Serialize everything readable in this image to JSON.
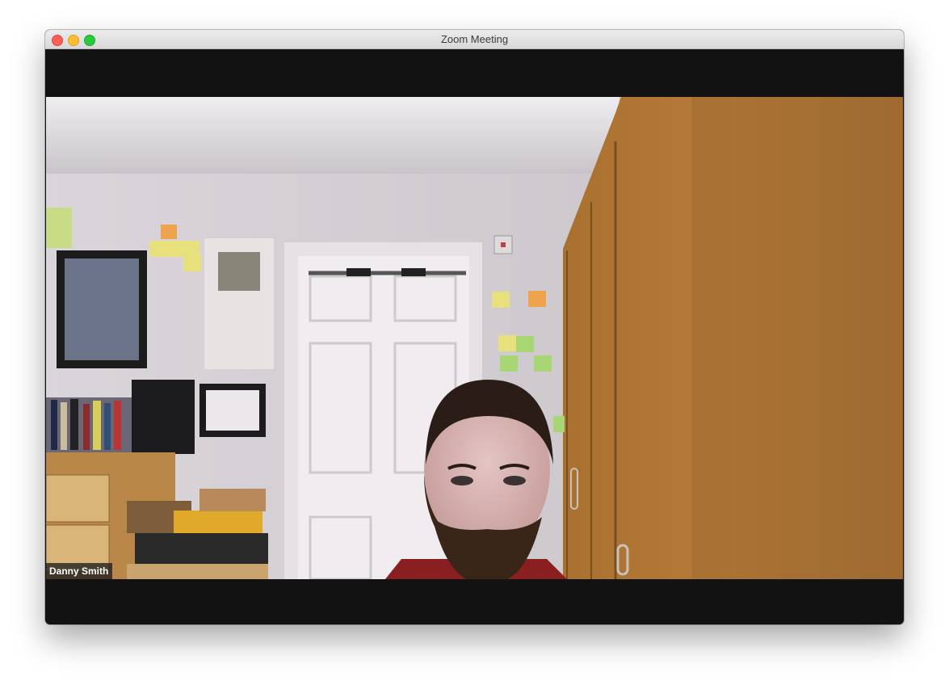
{
  "window": {
    "title": "Zoom Meeting",
    "controls": [
      "close",
      "minimize",
      "maximize"
    ]
  },
  "participant": {
    "name": "Danny Smith"
  },
  "colors": {
    "letterbox": "#121212",
    "close": "#fe5f57",
    "minimize": "#febc2e",
    "maximize": "#28c840"
  }
}
